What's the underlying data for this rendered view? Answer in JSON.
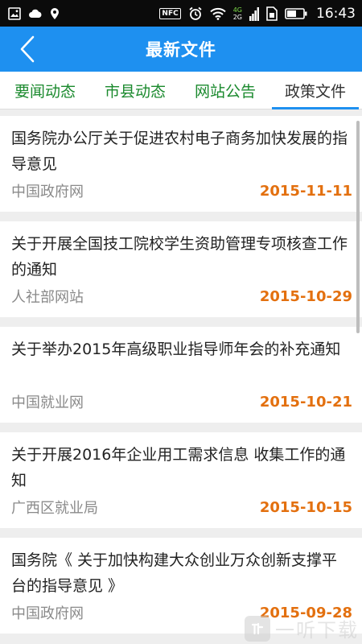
{
  "status_bar": {
    "time": "16:43",
    "nfc_label": "NFC",
    "network_top": "4G",
    "network_bottom": "2G",
    "left_icons": [
      "image-icon",
      "cloud-icon",
      "location-icon"
    ],
    "right_icons": [
      "nfc-icon",
      "alarm-icon",
      "wifi-icon",
      "signal-icon",
      "sim-icon",
      "battery-icon"
    ]
  },
  "app_bar": {
    "title": "最新文件"
  },
  "tabs": [
    {
      "label": "要闻动态",
      "active": false
    },
    {
      "label": "市县动态",
      "active": false
    },
    {
      "label": "网站公告",
      "active": false
    },
    {
      "label": "政策文件",
      "active": true
    }
  ],
  "articles": [
    {
      "title": "国务院办公厅关于促进农村电子商务加快发展的指导意见",
      "source": "中国政府网",
      "date": "2015-11-11"
    },
    {
      "title": "关于开展全国技工院校学生资助管理专项核查工作的通知",
      "source": "人社部网站",
      "date": "2015-10-29"
    },
    {
      "title": "关于举办2015年高级职业指导师年会的补充通知",
      "source": "中国就业网",
      "date": "2015-10-21"
    },
    {
      "title": "关于开展2016年企业用工需求信息 收集工作的通知",
      "source": "广西区就业局",
      "date": "2015-10-15"
    },
    {
      "title": "国务院《 关于加快构建大众创业万众创新支撑平台的指导意见 》",
      "source": "中国政府网",
      "date": "2015-09-28"
    }
  ],
  "watermark": {
    "text": "一听下载"
  },
  "colors": {
    "app_bar": "#1e90f0",
    "tab_text": "#1b8a2e",
    "date": "#e3700f",
    "source": "#8a8a8a"
  }
}
